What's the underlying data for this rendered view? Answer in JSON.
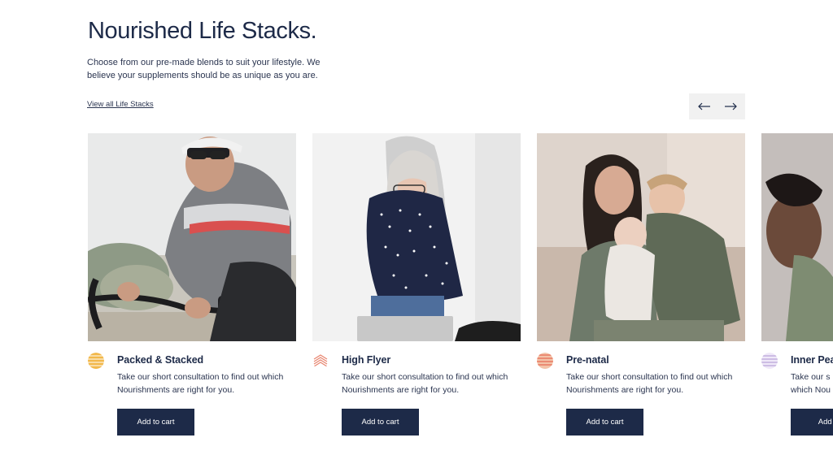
{
  "header": {
    "title": "Nourished Life Stacks.",
    "intro": "Choose from our pre-made blends to suit your lifestyle. We believe your supplements should be as unique as you are.",
    "view_all_link": "View all Life Stacks"
  },
  "carousel": {
    "prev_icon": "arrow-left-icon",
    "next_icon": "arrow-right-icon"
  },
  "products": [
    {
      "name": "Packed & Stacked",
      "description": "Take our short consultation to find out which Nourishments are right for you.",
      "button_label": "Add to cart",
      "badge_color": "#f2b84b",
      "image": "cyclist-riding-bike"
    },
    {
      "name": "High Flyer",
      "description": "Take our short consultation to find out which Nourishments are right for you.",
      "button_label": "Add to cart",
      "badge_color": "#e8856f",
      "image": "woman-at-laptop"
    },
    {
      "name": "Pre-natal",
      "description": "Take our short consultation to find out which Nourishments are right for you.",
      "button_label": "Add to cart",
      "badge_color": "#ec8f72",
      "image": "mother-with-children"
    },
    {
      "name": "Inner Pea",
      "description": "Take our s which Nou",
      "button_label": "Add to",
      "badge_color": "#b9a3d8",
      "image": "woman-resting"
    }
  ],
  "colors": {
    "primary": "#1d2a48",
    "arrow_bg": "#f1f1f1"
  }
}
